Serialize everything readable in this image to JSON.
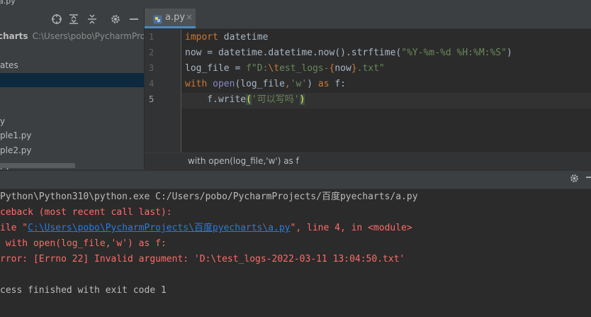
{
  "window_title_fragment": "a.py",
  "project": {
    "root_name": "charts",
    "root_path": "C:\\Users\\pobo\\PycharmProje",
    "items": [
      {
        "label": "ates",
        "selected": false
      },
      {
        "label": "",
        "selected": true
      },
      {
        "label": "",
        "selected": false
      },
      {
        "label": "y",
        "selected": false
      },
      {
        "label": "ple1.py",
        "selected": false
      },
      {
        "label": "ple2.py",
        "selected": false
      },
      {
        "label": "py",
        "selected": false
      }
    ],
    "toolbar_icons": [
      "crosshair-icon",
      "expand-all-icon",
      "collapse-all-icon",
      "gear-icon",
      "minimize-icon"
    ]
  },
  "editor": {
    "tab_label": "a.py",
    "tab_close": "×",
    "line_numbers": [
      "1",
      "2",
      "3",
      "4",
      "5"
    ],
    "lines": {
      "l1_kw": "import",
      "l1_rest": " datetime",
      "l2_a": "now = datetime.datetime.now().strftime(",
      "l2_str": "\"%Y-%m-%d %H:%M:%S\"",
      "l2_b": ")",
      "l3_a": "log_file = ",
      "l3_str1": "f\"D:",
      "l3_esc": "\\t",
      "l3_str2": "est_logs-",
      "l3_brace1": "{",
      "l3_var": "now",
      "l3_brace2": "}",
      "l3_str3": ".txt\"",
      "l4_kw": "with",
      "l4_sp": " ",
      "l4_bi": "open",
      "l4_a": "(log_file",
      "l4_comma": ",",
      "l4_str": "'w'",
      "l4_b": ") ",
      "l4_kw2": "as",
      "l4_c": " f:",
      "l5_a": "    f.write",
      "l5_p1": "(",
      "l5_str": "'可以写吗'",
      "l5_p2": ")"
    },
    "breadcrumb": "with open(log_file,'w') as f"
  },
  "run": {
    "icons": [
      "gear-icon",
      "minimize-icon"
    ],
    "console": {
      "cmd": "Python\\Python310\\python.exe C:/Users/pobo/PycharmProjects/百度pyecharts/a.py",
      "tb1": "ceback (most recent call last):",
      "tb2_a": "ile \"",
      "tb2_link": "C:\\Users\\pobo\\PycharmProjects\\百度pyecharts\\a.py",
      "tb2_b": "\", line 4, in <module>",
      "tb3": " with open(log_file,'w') as f:",
      "tb4": "rror: [Errno 22] Invalid argument: 'D:\\test_logs-2022-03-11 13:04:50.txt'",
      "exit": "cess finished with exit code 1"
    }
  },
  "colors": {
    "background": "#2b2b2b",
    "panel": "#3c3f41",
    "keyword": "#cc7832",
    "string": "#6a8759",
    "error": "#ff6b68",
    "link": "#287bde",
    "selection": "#0d293e"
  }
}
